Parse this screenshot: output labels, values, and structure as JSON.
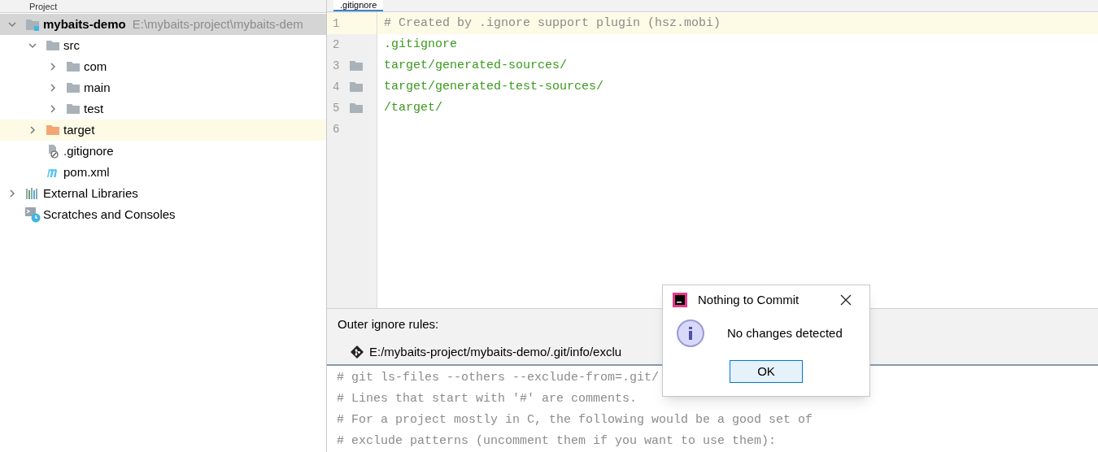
{
  "project_panel": {
    "title": "Project",
    "tree": [
      {
        "label": "mybaits-demo",
        "path": "E:\\mybaits-project\\mybaits-dem",
        "kind": "module",
        "expanded": true,
        "selected": true,
        "children": [
          {
            "label": "src",
            "kind": "folder",
            "expanded": true,
            "selected": false,
            "children": [
              {
                "label": "com",
                "kind": "folder",
                "expanded": false,
                "selected": false
              },
              {
                "label": "main",
                "kind": "folder",
                "expanded": false,
                "selected": false
              },
              {
                "label": "test",
                "kind": "folder",
                "expanded": false,
                "selected": false
              }
            ]
          },
          {
            "label": "target",
            "kind": "excluded",
            "expanded": false,
            "selected": false,
            "highlighted": true
          },
          {
            "label": ".gitignore",
            "kind": "ignore-file",
            "selected": false
          },
          {
            "label": "pom.xml",
            "kind": "maven",
            "selected": false
          }
        ]
      },
      {
        "label": "External Libraries",
        "kind": "libraries",
        "expanded": false,
        "selected": false
      },
      {
        "label": "Scratches and Consoles",
        "kind": "scratches",
        "selected": false
      }
    ]
  },
  "editor": {
    "tab": ".gitignore",
    "lines": [
      {
        "number": "1",
        "text": "# Created by .ignore support plugin (hsz.mobi)",
        "kind": "comment",
        "current": true,
        "folder_marker": false
      },
      {
        "number": "2",
        "text": ".gitignore",
        "kind": "entry",
        "current": false,
        "folder_marker": false
      },
      {
        "number": "3",
        "text": "target/generated-sources/",
        "kind": "entry",
        "current": false,
        "folder_marker": true
      },
      {
        "number": "4",
        "text": "target/generated-test-sources/",
        "kind": "entry",
        "current": false,
        "folder_marker": true
      },
      {
        "number": "5",
        "text": "/target/",
        "kind": "entry",
        "current": false,
        "folder_marker": true
      },
      {
        "number": "6",
        "current": false,
        "folder_marker": false
      }
    ]
  },
  "outer_rules": {
    "label": "Outer ignore rules:",
    "tab": "E:/mybaits-project/mybaits-demo/.git/info/exclu",
    "lines": [
      "# git ls-files --others --exclude-from=.git/",
      "# Lines that start with '#' are comments.",
      "# For a project mostly in C, the following would be a good set of",
      "# exclude patterns (uncomment them if you want to use them):"
    ]
  },
  "dialog": {
    "title": "Nothing to Commit",
    "message": "No changes detected",
    "button": "OK"
  }
}
